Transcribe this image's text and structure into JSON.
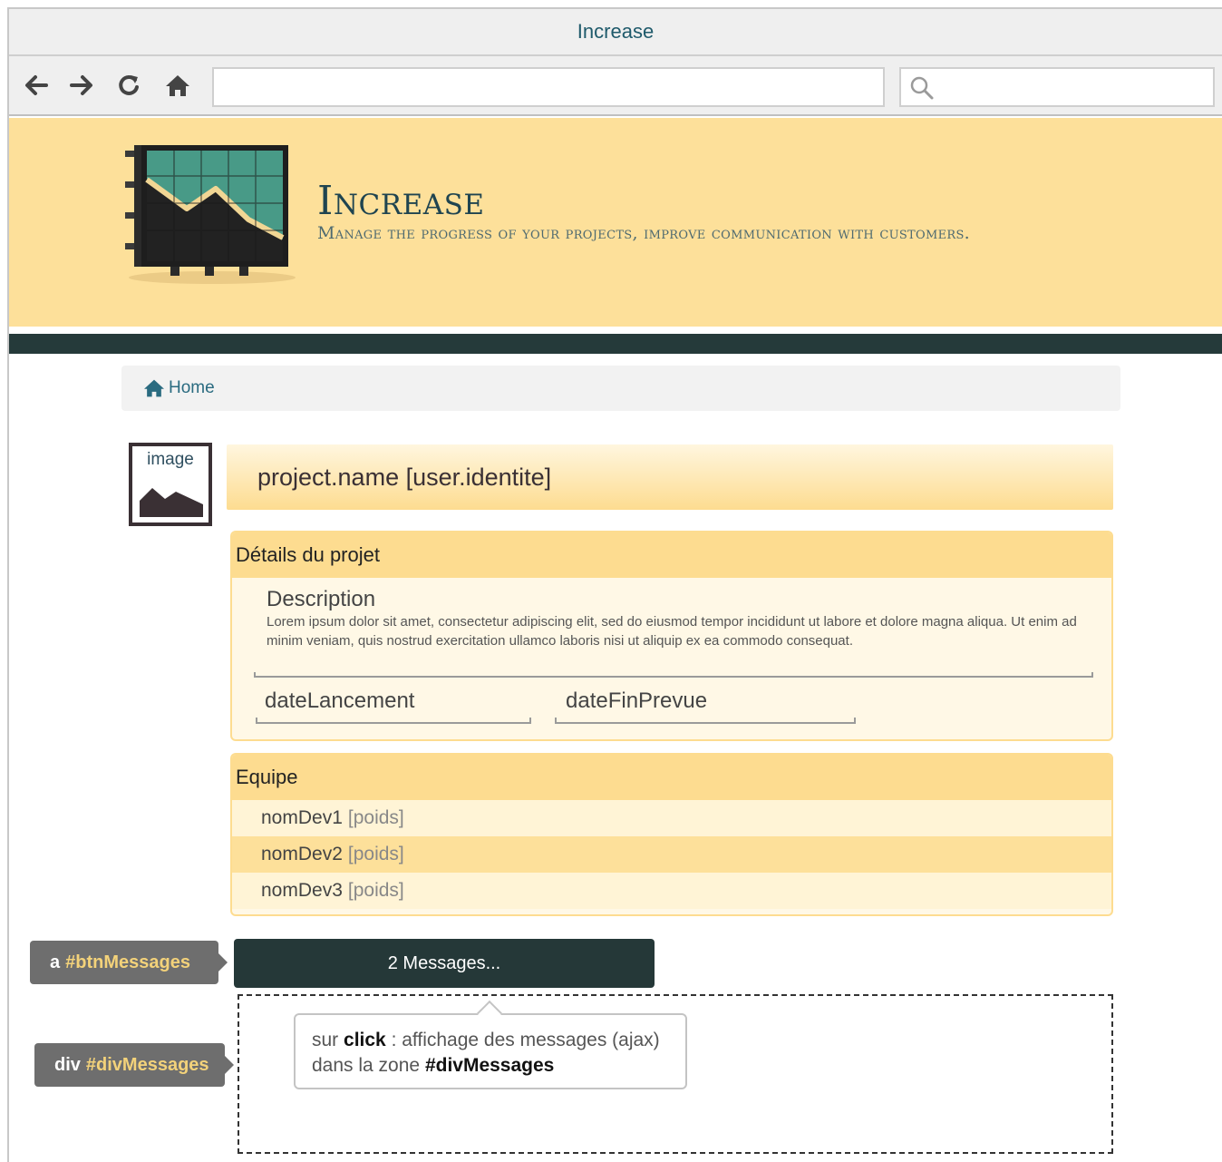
{
  "browser": {
    "window_title": "Increase",
    "url_value": "",
    "search_value": ""
  },
  "header": {
    "title": "Increase",
    "subtitle": "Manage the progress of your projects, improve communication with customers."
  },
  "breadcrumb": {
    "home_label": "Home"
  },
  "project": {
    "image_label": "image",
    "title": "project.name [user.identite]"
  },
  "details": {
    "heading": "Détails du projet",
    "description_label": "Description",
    "description_text": "Lorem ipsum dolor sit amet, consectetur adipiscing elit, sed do eiusmod tempor incididunt ut labore et dolore magna aliqua. Ut enim ad minim veniam, quis nostrud exercitation ullamco laboris nisi ut aliquip ex ea commodo consequat.",
    "date_start": "dateLancement",
    "date_end": "dateFinPrevue"
  },
  "team": {
    "heading": "Equipe",
    "members": [
      {
        "name": "nomDev1",
        "weight": "[poids]"
      },
      {
        "name": "nomDev2",
        "weight": "[poids]"
      },
      {
        "name": "nomDev3",
        "weight": "[poids]"
      }
    ]
  },
  "messages": {
    "button_label": "2 Messages...",
    "tooltip_pre": "sur ",
    "tooltip_click": "click",
    "tooltip_mid": " : affichage des messages (ajax) dans la zone ",
    "tooltip_target": "#divMessages"
  },
  "annotations": {
    "btn_tag": "a",
    "btn_selector": "#btnMessages",
    "div_tag": "div",
    "div_selector": "#divMessages"
  },
  "colors": {
    "header_bg": "#fde09a",
    "header_bar": "#253a3a",
    "button_bg": "#253838",
    "accent_text": "#1f4450"
  },
  "icons": {
    "back": "arrow-left-icon",
    "forward": "arrow-right-icon",
    "reload": "reload-icon",
    "home": "home-icon",
    "search": "search-icon",
    "logo": "chart-logo-icon",
    "image": "image-placeholder-icon"
  }
}
